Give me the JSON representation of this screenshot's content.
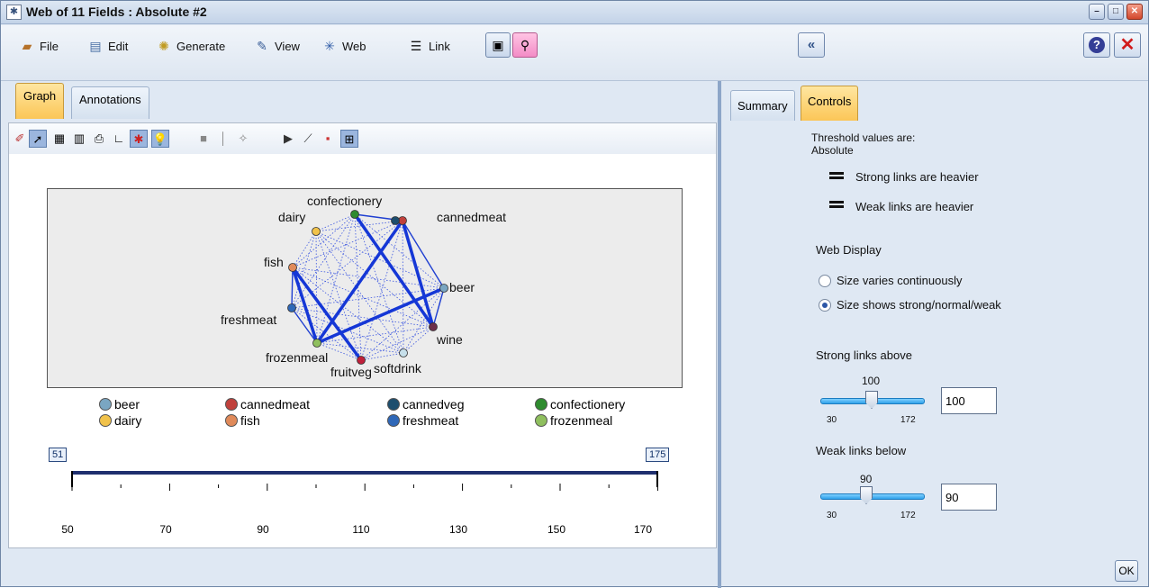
{
  "window": {
    "title": "Web of 11 Fields : Absolute #2",
    "buttons": [
      "minimize",
      "maximize",
      "close"
    ]
  },
  "menubar": {
    "items": [
      {
        "label": "File",
        "icon": "folder-icon"
      },
      {
        "label": "Edit",
        "icon": "edit-icon"
      },
      {
        "label": "Generate",
        "icon": "generate-icon"
      },
      {
        "label": "View",
        "icon": "view-icon"
      },
      {
        "label": "Web",
        "icon": "web-icon"
      },
      {
        "label": "Link",
        "icon": "link-icon"
      }
    ]
  },
  "left_tabs": [
    "Graph",
    "Annotations"
  ],
  "right_tabs": [
    "Summary",
    "Controls"
  ],
  "graph": {
    "nodes": [
      {
        "name": "confectionery",
        "color": "#2e8b2e"
      },
      {
        "name": "dairy",
        "color": "#f1c24a"
      },
      {
        "name": "cannedmeat",
        "color": "#c0413c"
      },
      {
        "name": "fish",
        "color": "#e08a5a"
      },
      {
        "name": "beer",
        "color": "#7aa6c2"
      },
      {
        "name": "freshmeat",
        "color": "#2f68b8"
      },
      {
        "name": "wine",
        "color": "#6d2e4a"
      },
      {
        "name": "frozenmeal",
        "color": "#8fbf5e"
      },
      {
        "name": "softdrink",
        "color": "#c6dfea"
      },
      {
        "name": "fruitveg",
        "color": "#c0203a"
      },
      {
        "name": "cannedveg",
        "color": "#1d4e6e"
      }
    ],
    "legend": [
      {
        "label": "beer",
        "color": "#7aa6c2"
      },
      {
        "label": "cannedmeat",
        "color": "#c0413c"
      },
      {
        "label": "cannedveg",
        "color": "#1d4e6e"
      },
      {
        "label": "confectionery",
        "color": "#2e8b2e"
      },
      {
        "label": "dairy",
        "color": "#f1c24a"
      },
      {
        "label": "fish",
        "color": "#e08a5a"
      },
      {
        "label": "freshmeat",
        "color": "#2f68b8"
      },
      {
        "label": "frozenmeal",
        "color": "#8fbf5e"
      }
    ],
    "range": {
      "min_box": "51",
      "max_box": "175"
    },
    "axis_labels": [
      "50",
      "70",
      "90",
      "110",
      "130",
      "150",
      "170"
    ]
  },
  "controls": {
    "threshold_label": "Threshold values are:",
    "threshold_value": "Absolute",
    "strong_heavier": "Strong links are heavier",
    "weak_heavier": "Weak links are heavier",
    "web_display": "Web Display",
    "size_continuous": "Size varies continuously",
    "size_strong": "Size shows strong/normal/weak",
    "strong_links_above": "Strong links above",
    "strong_value_label": "100",
    "strong_min": "30",
    "strong_max": "172",
    "strong_input": "100",
    "weak_links_below": "Weak links below",
    "weak_value_label": "90",
    "weak_min": "30",
    "weak_max": "172",
    "weak_input": "90",
    "ok_label": "OK"
  }
}
